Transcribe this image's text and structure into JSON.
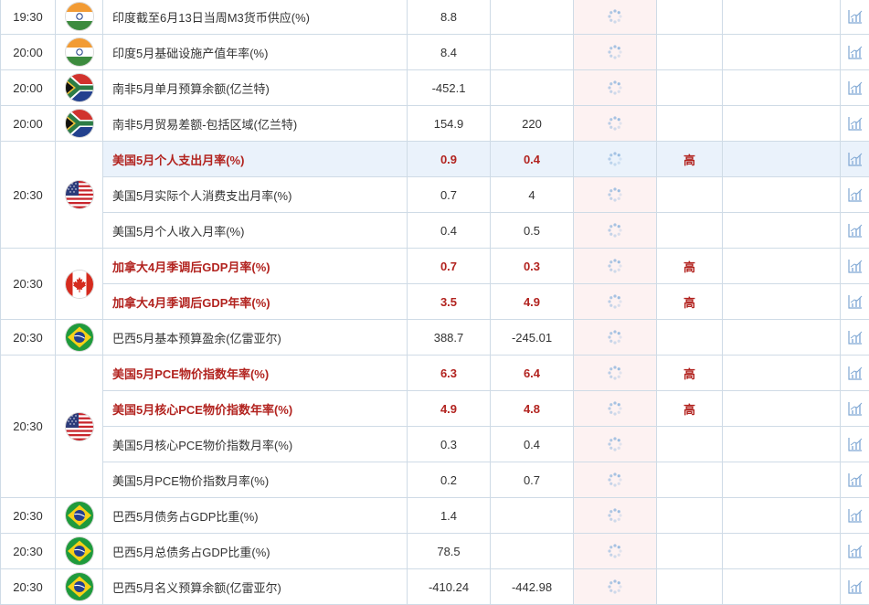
{
  "colors": {
    "important_text": "#b2231f",
    "border": "#cfdbe6",
    "highlight_row": "#eaf2fb",
    "published_col_bg": "#fdf2f2"
  },
  "groups": [
    {
      "time": "19:30",
      "country": "india-flag-icon",
      "rows": [
        {
          "name": "印度截至6月13日当周M3货币供应(%)",
          "actual": "8.8",
          "forecast": "",
          "importance": ""
        }
      ]
    },
    {
      "time": "20:00",
      "country": "india-flag-icon",
      "rows": [
        {
          "name": "印度5月基础设施产值年率(%)",
          "actual": "8.4",
          "forecast": "",
          "importance": ""
        }
      ]
    },
    {
      "time": "20:00",
      "country": "south-africa-flag-icon",
      "rows": [
        {
          "name": "南非5月单月预算余额(亿兰特)",
          "actual": "-452.1",
          "forecast": "",
          "importance": ""
        }
      ]
    },
    {
      "time": "20:00",
      "country": "south-africa-flag-icon",
      "rows": [
        {
          "name": "南非5月贸易差额-包括区域(亿兰特)",
          "actual": "154.9",
          "forecast": "220",
          "importance": ""
        }
      ]
    },
    {
      "time": "20:30",
      "country": "usa-flag-icon",
      "rows": [
        {
          "name": "美国5月个人支出月率(%)",
          "actual": "0.9",
          "forecast": "0.4",
          "importance": "高",
          "bold": true,
          "highlight": true
        },
        {
          "name": "美国5月实际个人消费支出月率(%)",
          "actual": "0.7",
          "forecast": "4",
          "importance": ""
        },
        {
          "name": "美国5月个人收入月率(%)",
          "actual": "0.4",
          "forecast": "0.5",
          "importance": ""
        }
      ]
    },
    {
      "time": "20:30",
      "country": "canada-flag-icon",
      "rows": [
        {
          "name": "加拿大4月季调后GDP月率(%)",
          "actual": "0.7",
          "forecast": "0.3",
          "importance": "高",
          "bold": true
        },
        {
          "name": "加拿大4月季调后GDP年率(%)",
          "actual": "3.5",
          "forecast": "4.9",
          "importance": "高",
          "bold": true
        }
      ]
    },
    {
      "time": "20:30",
      "country": "brazil-flag-icon",
      "rows": [
        {
          "name": "巴西5月基本预算盈余(亿雷亚尔)",
          "actual": "388.7",
          "forecast": "-245.01",
          "importance": ""
        }
      ]
    },
    {
      "time": "20:30",
      "country": "usa-flag-icon",
      "rows": [
        {
          "name": "美国5月PCE物价指数年率(%)",
          "actual": "6.3",
          "forecast": "6.4",
          "importance": "高",
          "bold": true
        },
        {
          "name": "美国5月核心PCE物价指数年率(%)",
          "actual": "4.9",
          "forecast": "4.8",
          "importance": "高",
          "bold": true
        },
        {
          "name": "美国5月核心PCE物价指数月率(%)",
          "actual": "0.3",
          "forecast": "0.4",
          "importance": ""
        },
        {
          "name": "美国5月PCE物价指数月率(%)",
          "actual": "0.2",
          "forecast": "0.7",
          "importance": ""
        }
      ]
    },
    {
      "time": "20:30",
      "country": "brazil-flag-icon",
      "rows": [
        {
          "name": "巴西5月债务占GDP比重(%)",
          "actual": "1.4",
          "forecast": "",
          "importance": ""
        }
      ]
    },
    {
      "time": "20:30",
      "country": "brazil-flag-icon",
      "rows": [
        {
          "name": "巴西5月总债务占GDP比重(%)",
          "actual": "78.5",
          "forecast": "",
          "importance": ""
        }
      ]
    },
    {
      "time": "20:30",
      "country": "brazil-flag-icon",
      "rows": [
        {
          "name": "巴西5月名义预算余额(亿雷亚尔)",
          "actual": "-410.24",
          "forecast": "-442.98",
          "importance": ""
        }
      ]
    }
  ]
}
